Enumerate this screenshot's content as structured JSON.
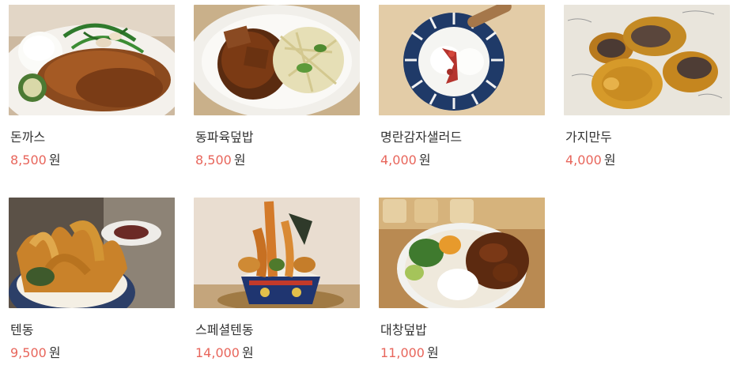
{
  "menu": {
    "items": [
      {
        "name": "돈까스",
        "price": "8,500",
        "unit": "원",
        "photo": "tonkatsu-photo"
      },
      {
        "name": "동파육덮밥",
        "price": "8,500",
        "unit": "원",
        "photo": "dongpayuk-rice-bowl-photo"
      },
      {
        "name": "명란감자샐러드",
        "price": "4,000",
        "unit": "원",
        "photo": "mentaiko-potato-salad-photo"
      },
      {
        "name": "가지만두",
        "price": "4,000",
        "unit": "원",
        "photo": "eggplant-dumpling-photo"
      },
      {
        "name": "텐동",
        "price": "9,500",
        "unit": "원",
        "photo": "tendon-photo"
      },
      {
        "name": "스페셜텐동",
        "price": "14,000",
        "unit": "원",
        "photo": "special-tendon-photo"
      },
      {
        "name": "대창덮밥",
        "price": "11,000",
        "unit": "원",
        "photo": "daechang-rice-bowl-photo"
      }
    ]
  },
  "colors": {
    "price": "#e8665c",
    "text": "#333333"
  }
}
